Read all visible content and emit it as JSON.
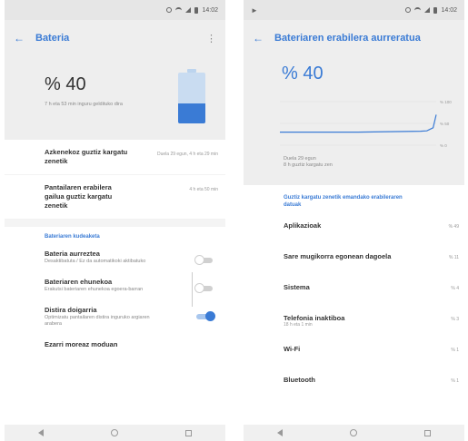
{
  "left": {
    "status": {
      "time": "14:02"
    },
    "appbar": {
      "title": "Bateria"
    },
    "header": {
      "percent": "% 40",
      "subtitle": "7 h eta 53 min inguru geldituko dira",
      "level": 0.4,
      "fill_color": "#3a7bd5"
    },
    "stats": [
      {
        "label": "Azkenekoz guztiz kargatu zenetik",
        "value": "Duela 29 egun, 4 h eta 29 min"
      },
      {
        "label": "Pantailaren erabilera gailua guztiz kargatu zenetik",
        "value": "4 h eta 50 min"
      }
    ],
    "section_title": "Bateriaren kudeaketa",
    "toggles": [
      {
        "label": "Bateria aurreztea",
        "desc": "Desaktibatuta / Ez da automatikoki aktibatuko",
        "on": false
      },
      {
        "label": "Bateriaren ehunekoa",
        "desc": "Erakutsi bateriaren ehunekoa egoera-barran",
        "on": false
      },
      {
        "label": "Distira doigarria",
        "desc": "Optimizatu pantailaren distira inguruko argiaren arabera",
        "on": true
      }
    ],
    "last_item": "Ezarri moreaz moduan"
  },
  "right": {
    "status": {
      "time": "14:02"
    },
    "appbar": {
      "title": "Bateriaren erabilera aurreratua"
    },
    "header": {
      "percent": "% 40",
      "usage_lines": [
        "Duela 29 egun",
        "8 h guztiz kargatu zen"
      ]
    },
    "chart_data": {
      "type": "line",
      "ylabels": [
        "% 100",
        "% 50",
        "% 0"
      ],
      "x": [
        0,
        0.5,
        0.9,
        0.94,
        0.98,
        1.0
      ],
      "y": [
        30,
        30,
        32,
        33,
        40,
        70
      ],
      "color": "#3a7bd5"
    },
    "section_title": "Guztiz kargatu zenetik emandako erabileraren datuak",
    "usage": [
      {
        "label": "Aplikazioak",
        "value": "% 49"
      },
      {
        "label": "Sare mugikorra egonean dagoela",
        "value": "% 11"
      },
      {
        "label": "Sistema",
        "value": "% 4"
      },
      {
        "label": "Telefonia inaktiboa",
        "sub": "18 h eta 1 min",
        "value": "% 3"
      },
      {
        "label": "Wi-Fi",
        "value": "% 1"
      },
      {
        "label": "Bluetooth",
        "value": "% 1"
      }
    ]
  }
}
